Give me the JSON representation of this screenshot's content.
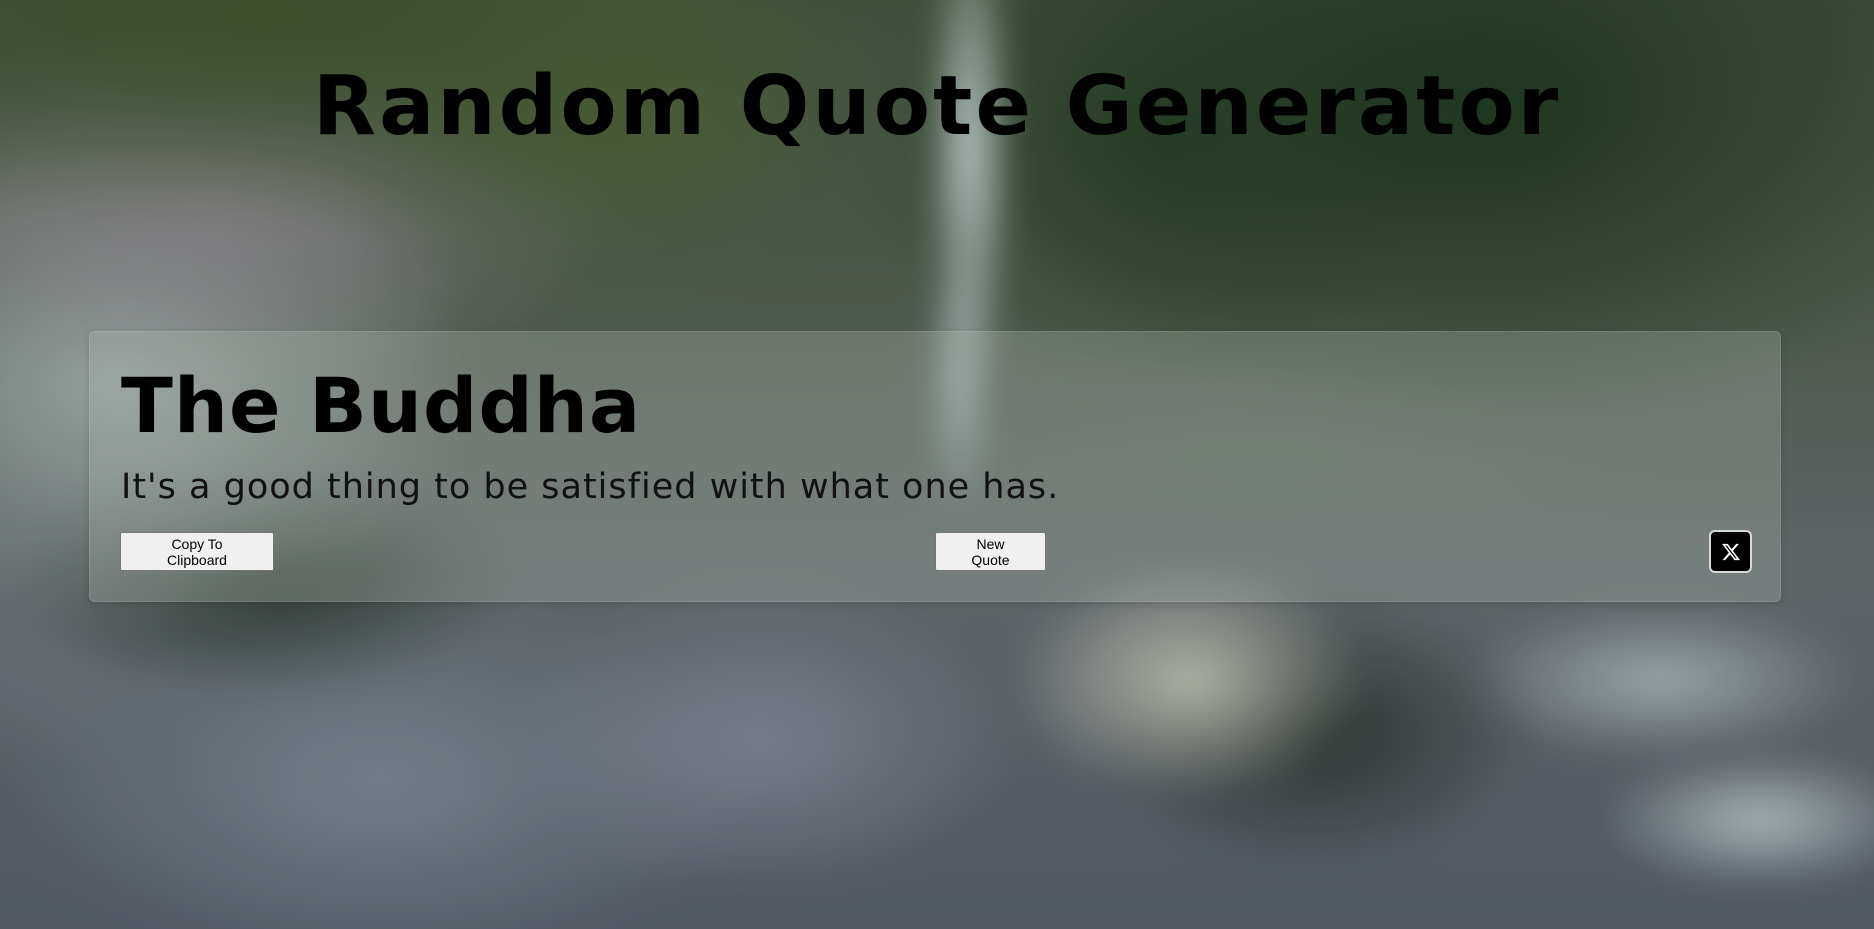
{
  "header": {
    "title": "Random Quote Generator"
  },
  "quote": {
    "author": "The Buddha",
    "text": "It's a good thing to be satisfied with what one has."
  },
  "actions": {
    "copy_label": "Copy To Clipboard",
    "new_quote_label": "New Quote",
    "share_icon": "x-logo-icon"
  },
  "colors": {
    "title_text": "#000000",
    "card_background": "rgba(170,180,170,0.32)",
    "button_background": "#f0f0f0",
    "share_button_background": "#000000"
  }
}
